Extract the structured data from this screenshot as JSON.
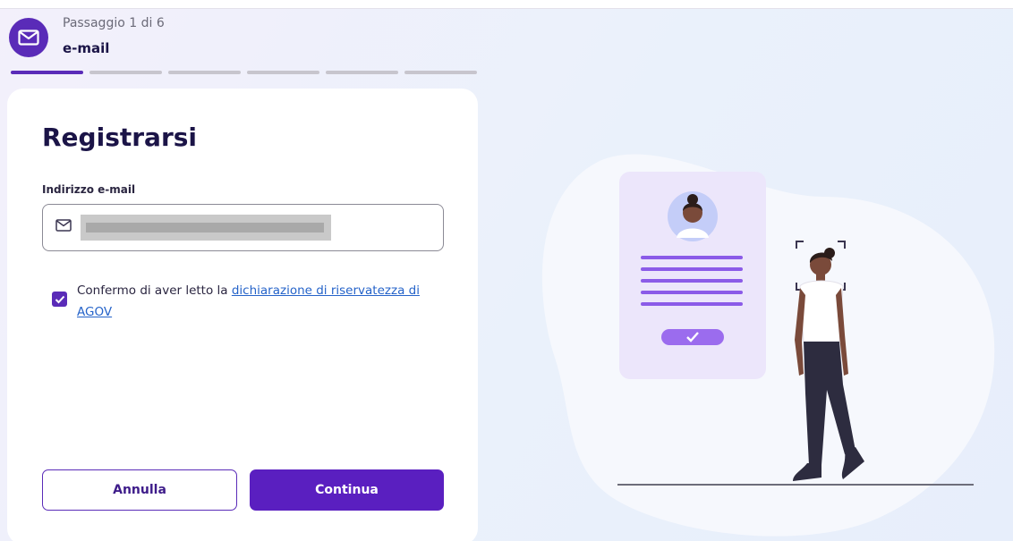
{
  "header": {
    "step_label": "Passaggio 1 di 6",
    "step_name": "e-mail",
    "icon": "envelope-icon",
    "total_steps": 6,
    "current_step": 1
  },
  "form": {
    "title": "Registrarsi",
    "email_label": "Indirizzo e-mail",
    "email_value": "",
    "consent_prefix": "Confermo di aver letto la ",
    "consent_link": "dichiarazione di riservatezza di AGOV",
    "consent_checked": true,
    "cancel_label": "Annulla",
    "continue_label": "Continua"
  },
  "colors": {
    "accent": "#5a2bb8",
    "primary_button": "#5a1fc0",
    "link": "#2563c9"
  }
}
